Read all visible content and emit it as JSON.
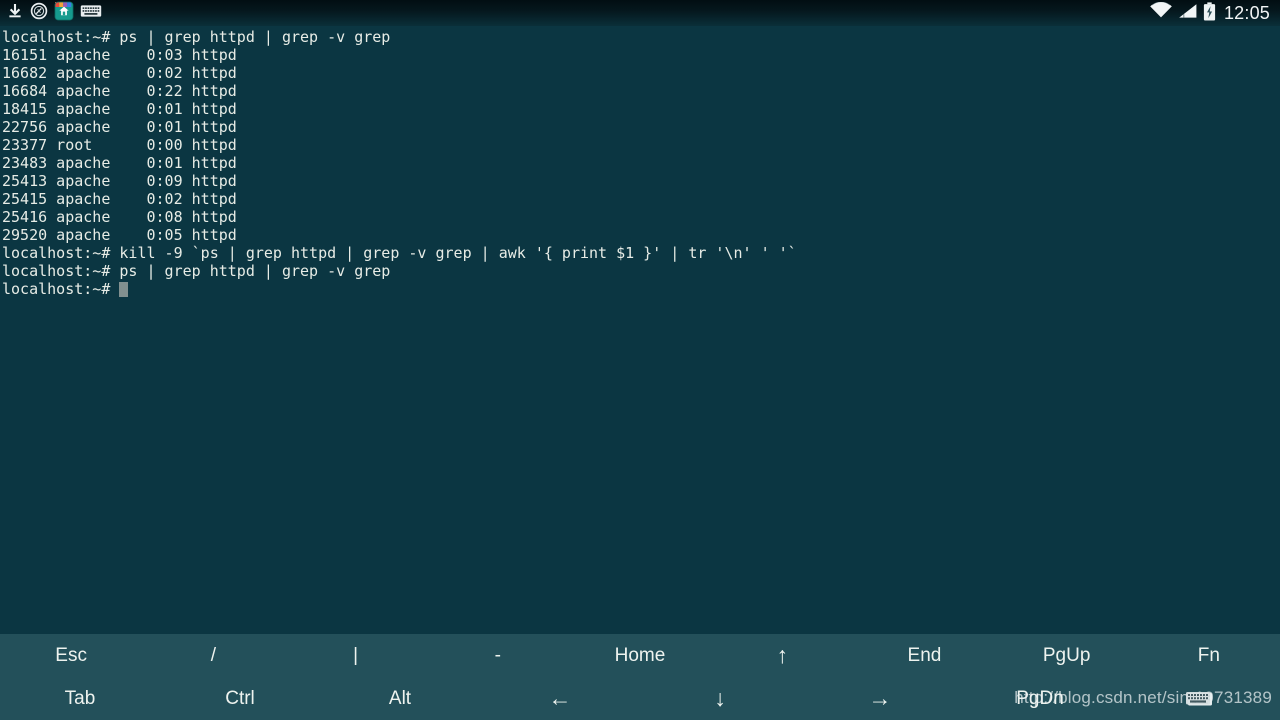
{
  "statusbar": {
    "icons_left": [
      "download-icon",
      "compass-icon",
      "app-icon",
      "keyboard-icon"
    ],
    "icons_right": [
      "wifi-icon",
      "signal-icon",
      "battery-charging-icon"
    ],
    "clock": "12:05"
  },
  "terminal": {
    "prompt": "localhost:~#",
    "lines": [
      "localhost:~# ps | grep httpd | grep -v grep",
      "16151 apache    0:03 httpd",
      "16682 apache    0:02 httpd",
      "16684 apache    0:22 httpd",
      "18415 apache    0:01 httpd",
      "22756 apache    0:01 httpd",
      "23377 root      0:00 httpd",
      "23483 apache    0:01 httpd",
      "25413 apache    0:09 httpd",
      "25415 apache    0:02 httpd",
      "25416 apache    0:08 httpd",
      "29520 apache    0:05 httpd",
      "localhost:~# kill -9 `ps | grep httpd | grep -v grep | awk '{ print $1 }' | tr '\\n' ' '`",
      "localhost:~# ps | grep httpd | grep -v grep"
    ],
    "last_line": "localhost:~# ",
    "processes": [
      {
        "pid": "16151",
        "user": "apache",
        "time": "0:03",
        "command": "httpd"
      },
      {
        "pid": "16682",
        "user": "apache",
        "time": "0:02",
        "command": "httpd"
      },
      {
        "pid": "16684",
        "user": "apache",
        "time": "0:22",
        "command": "httpd"
      },
      {
        "pid": "18415",
        "user": "apache",
        "time": "0:01",
        "command": "httpd"
      },
      {
        "pid": "22756",
        "user": "apache",
        "time": "0:01",
        "command": "httpd"
      },
      {
        "pid": "23377",
        "user": "root",
        "time": "0:00",
        "command": "httpd"
      },
      {
        "pid": "23483",
        "user": "apache",
        "time": "0:01",
        "command": "httpd"
      },
      {
        "pid": "25413",
        "user": "apache",
        "time": "0:09",
        "command": "httpd"
      },
      {
        "pid": "25415",
        "user": "apache",
        "time": "0:02",
        "command": "httpd"
      },
      {
        "pid": "25416",
        "user": "apache",
        "time": "0:08",
        "command": "httpd"
      },
      {
        "pid": "29520",
        "user": "apache",
        "time": "0:05",
        "command": "httpd"
      }
    ]
  },
  "keyboard": {
    "row1": [
      {
        "label": "Esc",
        "name": "key-esc"
      },
      {
        "label": "/",
        "name": "key-slash"
      },
      {
        "label": "|",
        "name": "key-pipe"
      },
      {
        "label": "-",
        "name": "key-minus"
      },
      {
        "label": "Home",
        "name": "key-home"
      },
      {
        "label": "↑",
        "name": "key-arrow-up"
      },
      {
        "label": "End",
        "name": "key-end"
      },
      {
        "label": "PgUp",
        "name": "key-pgup"
      },
      {
        "label": "Fn",
        "name": "key-fn"
      }
    ],
    "row2": [
      {
        "label": "Tab",
        "name": "key-tab"
      },
      {
        "label": "Ctrl",
        "name": "key-ctrl"
      },
      {
        "label": "Alt",
        "name": "key-alt"
      },
      {
        "label": "←",
        "name": "key-arrow-left"
      },
      {
        "label": "↓",
        "name": "key-arrow-down"
      },
      {
        "label": "→",
        "name": "key-arrow-right"
      },
      {
        "label": "PgDn",
        "name": "key-pgdn"
      },
      {
        "label": "",
        "name": "key-keyboard-toggle"
      }
    ]
  },
  "watermark": {
    "text_before": "http://blog.csdn.net/sina",
    "text_after": "19731389"
  },
  "colors": {
    "terminal_bg": "#0b3642",
    "terminal_fg": "#e7ece6",
    "keybar_bg": "#23505a",
    "statusbar_bg": "#05171d",
    "cursor": "#82908f"
  }
}
